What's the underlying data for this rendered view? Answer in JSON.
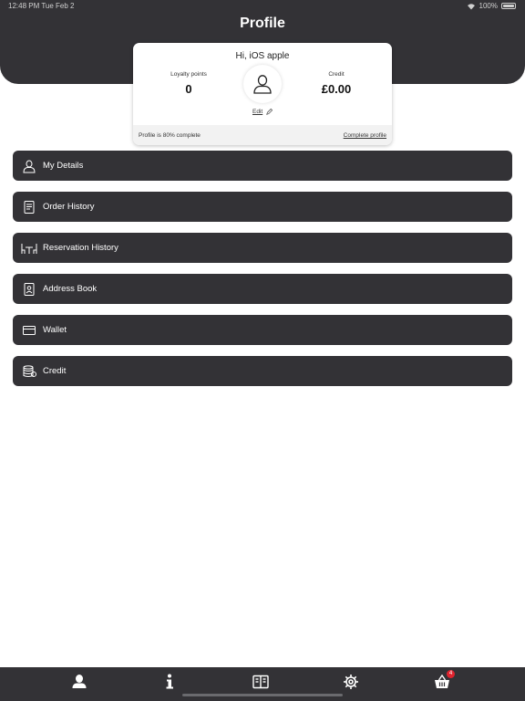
{
  "status_bar": {
    "time": "12:48 PM",
    "date": "Tue Feb 2",
    "battery": "100%"
  },
  "header": {
    "title": "Profile"
  },
  "profile_card": {
    "greeting": "Hi, iOS apple",
    "loyalty_label": "Loyalty points",
    "loyalty_value": "0",
    "credit_label": "Credit",
    "credit_value": "£0.00",
    "edit_label": "Edit",
    "progress_text": "Profile is 80% complete",
    "complete_profile_label": "Complete profile"
  },
  "menu": {
    "items": [
      {
        "label": "My Details",
        "icon": "user-icon"
      },
      {
        "label": "Order History",
        "icon": "receipt-icon"
      },
      {
        "label": "Reservation History",
        "icon": "table-chairs-icon"
      },
      {
        "label": "Address Book",
        "icon": "address-book-icon"
      },
      {
        "label": "Wallet",
        "icon": "card-icon"
      },
      {
        "label": "Credit",
        "icon": "coins-icon"
      }
    ]
  },
  "tabbar": {
    "tabs": [
      {
        "name": "profile",
        "icon": "person-icon",
        "active": true
      },
      {
        "name": "info",
        "icon": "info-icon"
      },
      {
        "name": "menu",
        "icon": "menu-book-icon"
      },
      {
        "name": "settings",
        "icon": "gear-icon"
      },
      {
        "name": "basket",
        "icon": "basket-icon"
      }
    ],
    "basket_badge": "4"
  },
  "colors": {
    "dark": "#333236",
    "badge": "#e0232e"
  }
}
